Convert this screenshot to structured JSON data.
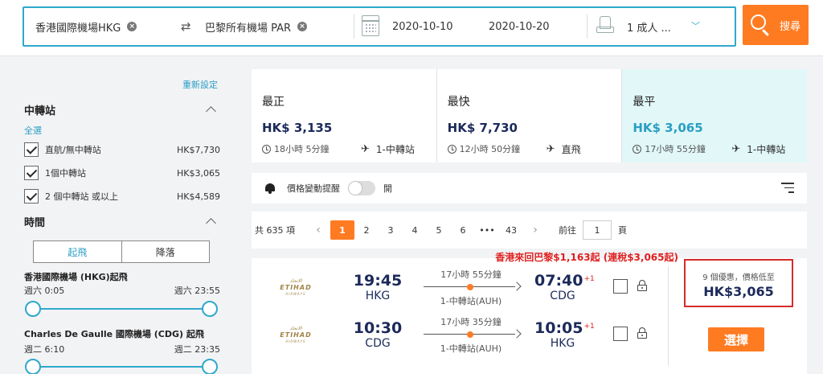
{
  "search": {
    "origin": "香港國際機場HKG",
    "destination": "巴黎所有機場 PAR",
    "depart_date": "2020-10-10",
    "return_date": "2020-10-20",
    "passengers": "1 成人 ...",
    "search_label": "搜尋"
  },
  "filters": {
    "reset_label": "重新設定",
    "stops_title": "中轉站",
    "select_all": "全選",
    "stops": [
      {
        "label": "直航/無中轉站",
        "price": "HK$7,730",
        "checked": true
      },
      {
        "label": "1個中轉站",
        "price": "HK$3,065",
        "checked": true
      },
      {
        "label": "2 個中轉站 或以上",
        "price": "HK$4,589",
        "checked": true
      }
    ],
    "time_title": "時間",
    "time_tabs": [
      "起飛",
      "降落"
    ],
    "departures": [
      {
        "title": "香港國際機場 (HKG)起飛",
        "min": "週六 0:05",
        "max": "週六 23:55"
      },
      {
        "title": "Charles De Gaulle 國際機場 (CDG) 起飛",
        "min": "週二 6:10",
        "max": "週二 23:35"
      }
    ]
  },
  "sort": [
    {
      "title": "最正",
      "price": "HK$ 3,135",
      "duration": "18小時 5分鐘",
      "stops": "1-中轉站",
      "active": false
    },
    {
      "title": "最快",
      "price": "HK$ 7,730",
      "duration": "12小時 50分鐘",
      "stops": "直飛",
      "active": false
    },
    {
      "title": "最平",
      "price": "HK$ 3,065",
      "duration": "17小時 55分鐘",
      "stops": "1-中轉站",
      "active": true
    }
  ],
  "alert": {
    "label": "價格變動提醒",
    "toggle_label": "開"
  },
  "pager": {
    "total": "共 635 項",
    "pages": [
      "1",
      "2",
      "3",
      "4",
      "5",
      "6",
      "•••",
      "43"
    ],
    "current": "1",
    "goto_prefix": "前往",
    "goto_value": "1",
    "goto_suffix": "頁"
  },
  "result": {
    "promo": "香港來回巴黎$1,163起 (連稅$3,065起)",
    "airline_logo": {
      "arabic": "الاتحاد",
      "english": "ETIHAD",
      "sub": "AIRWAYS"
    },
    "legs": [
      {
        "dep_time": "19:45",
        "dep_airport": "HKG",
        "duration": "17小時 55分鐘",
        "stops": "1-中轉站(AUH)",
        "arr_time": "07:40",
        "arr_plus": "+1",
        "arr_airport": "CDG"
      },
      {
        "dep_time": "10:30",
        "dep_airport": "CDG",
        "duration": "17小時 35分鐘",
        "stops": "1-中轉站(AUH)",
        "arr_time": "10:05",
        "arr_plus": "+1",
        "arr_airport": "HKG"
      }
    ],
    "deals": "9 個優惠，價格低至",
    "deal_price": "HK$3,065",
    "select_label": "選擇"
  },
  "colors": {
    "accent": "#2fa8cc",
    "orange": "#ff7b22",
    "navy": "#1c2a5a",
    "red": "#e02020"
  }
}
